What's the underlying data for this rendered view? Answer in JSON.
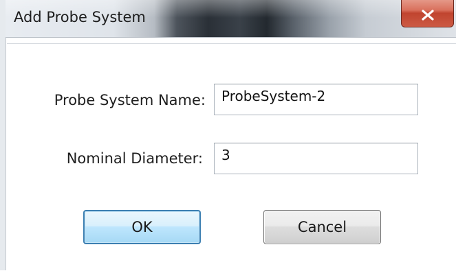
{
  "window": {
    "title": "Add Probe System",
    "close_icon": "close-icon"
  },
  "form": {
    "probe_system_name_label": "Probe System Name:",
    "probe_system_name_value": "ProbeSystem-2",
    "nominal_diameter_label": "Nominal Diameter:",
    "nominal_diameter_value": "3"
  },
  "buttons": {
    "ok_label": "OK",
    "cancel_label": "Cancel"
  }
}
